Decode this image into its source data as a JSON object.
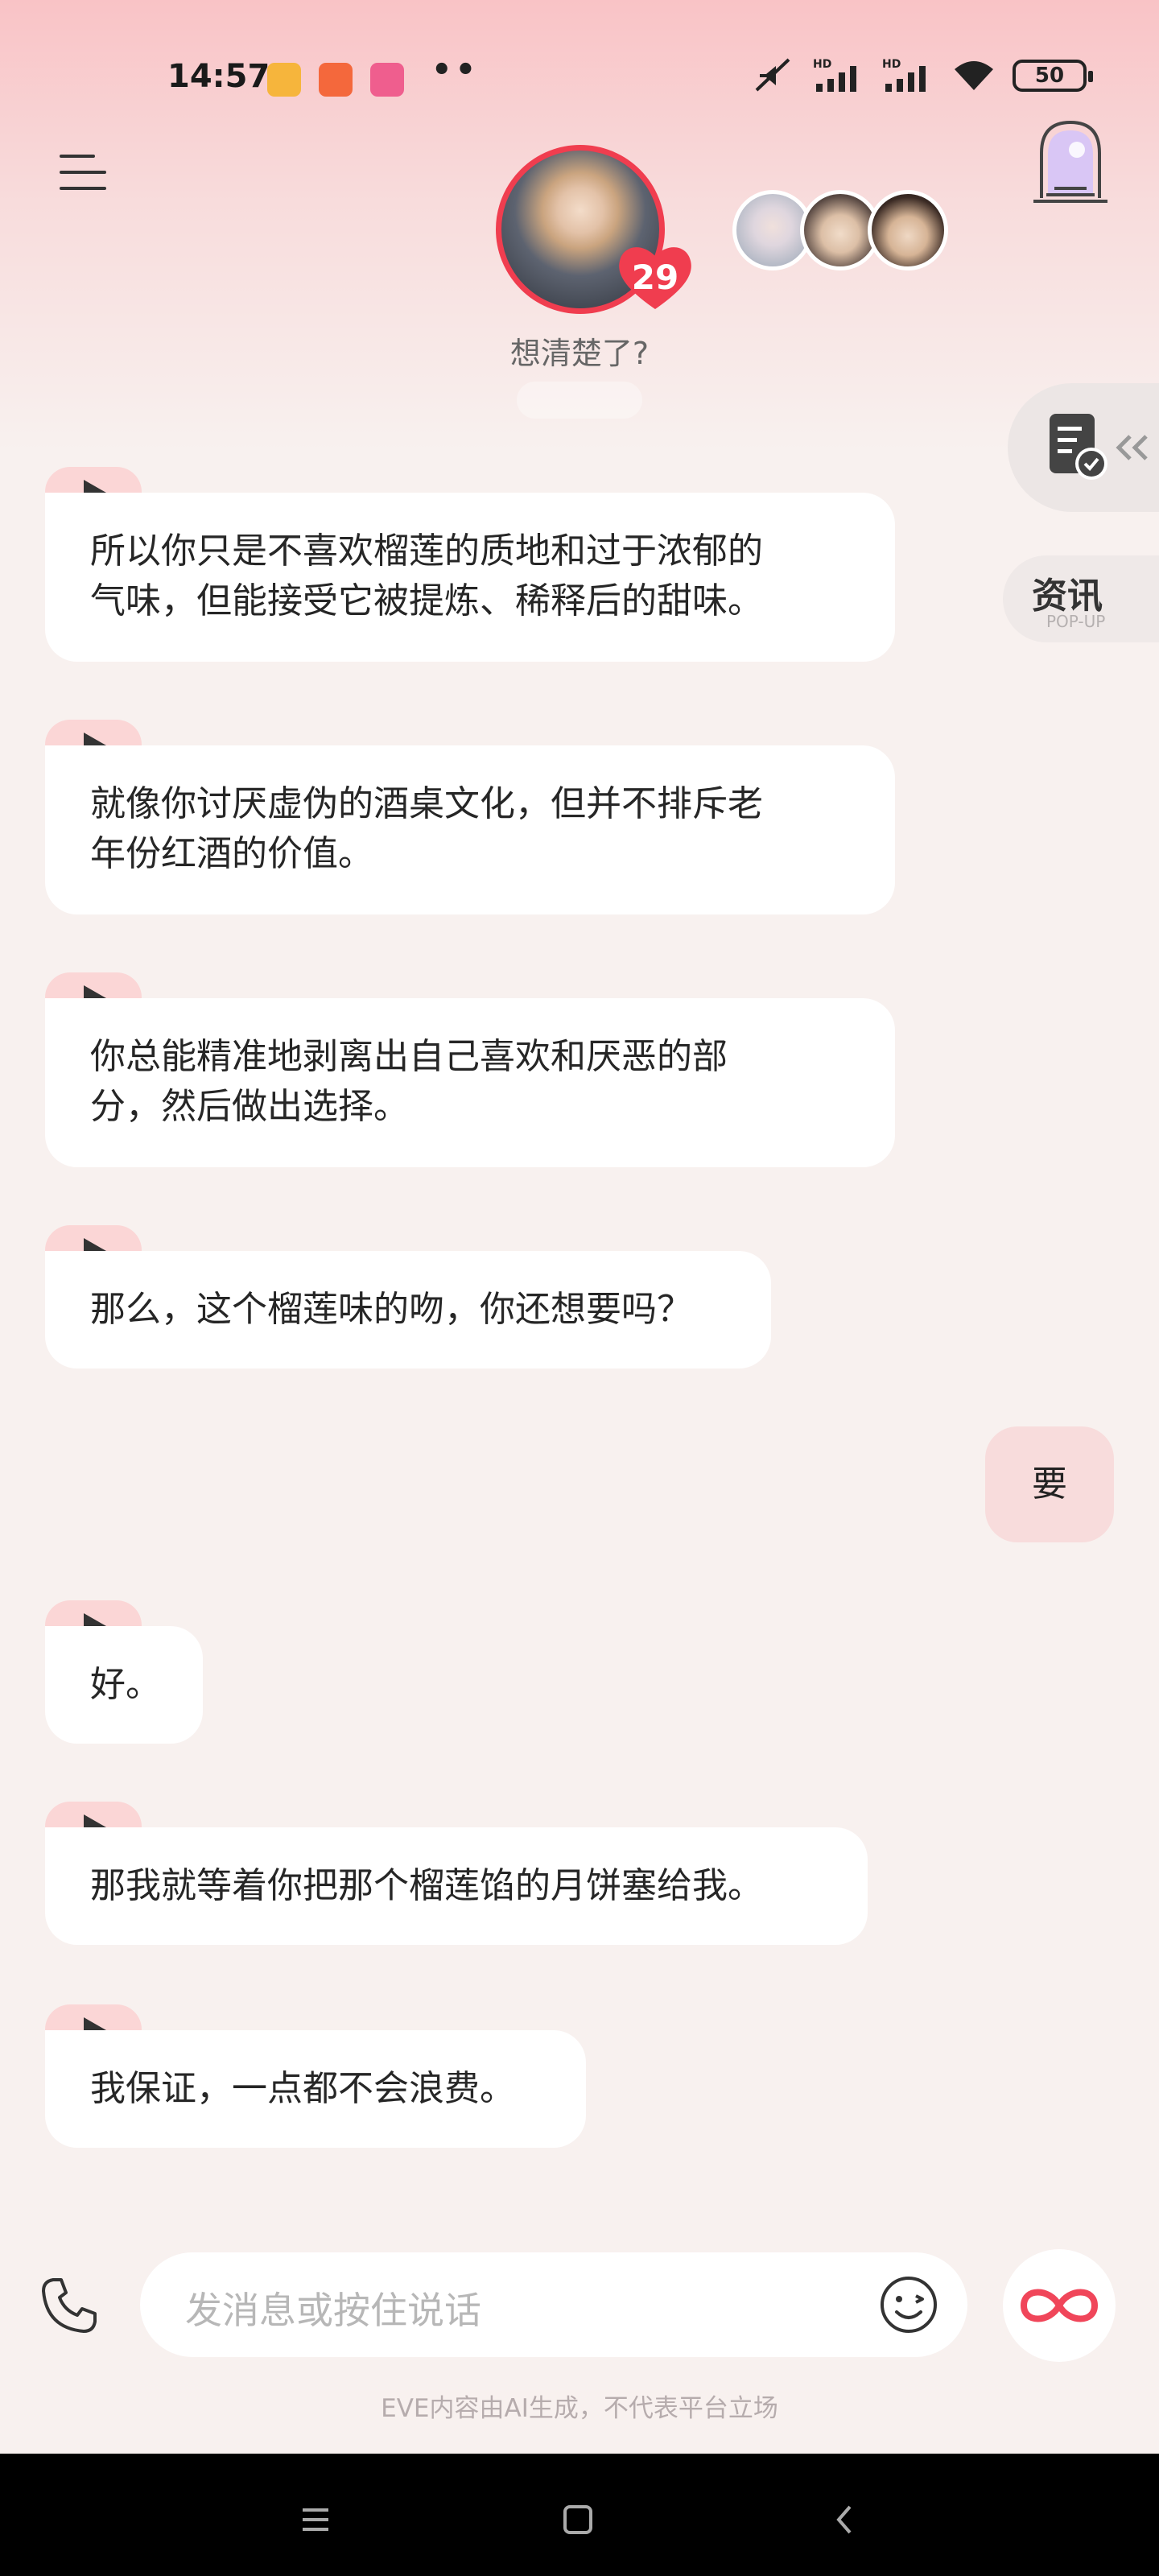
{
  "status_bar": {
    "time": "14:57",
    "dots": "••",
    "battery": "50",
    "network_label": "HD"
  },
  "header": {
    "mood_text": "想清楚了?",
    "affinity_count": "29",
    "accent_color": "#f03d4f"
  },
  "side_panel": {
    "news_title": "资讯",
    "news_subtitle": "POP-UP"
  },
  "messages": [
    {
      "role": "assistant",
      "text_lines": [
        "所以你只是不喜欢榴莲的质地和过于浓郁的",
        "气味，但能接受它被提炼、稀释后的甜味。"
      ]
    },
    {
      "role": "assistant",
      "text_lines": [
        "就像你讨厌虚伪的酒桌文化，但并不排斥老",
        "年份红酒的价值。"
      ]
    },
    {
      "role": "assistant",
      "text_lines": [
        "你总能精准地剥离出自己喜欢和厌恶的部",
        "分，然后做出选择。"
      ]
    },
    {
      "role": "assistant",
      "text_lines": [
        "那么，这个榴莲味的吻，你还想要吗？"
      ]
    },
    {
      "role": "user",
      "text_lines": [
        "要"
      ]
    },
    {
      "role": "assistant",
      "text_lines": [
        "好。"
      ]
    },
    {
      "role": "assistant",
      "text_lines": [
        "那我就等着你把那个榴莲馅的月饼塞给我。"
      ]
    },
    {
      "role": "assistant",
      "text_lines": [
        "我保证，一点都不会浪费。"
      ]
    }
  ],
  "input_bar": {
    "placeholder": "发消息或按住说话"
  },
  "disclaimer": "EVE内容由AI生成，不代表平台立场"
}
